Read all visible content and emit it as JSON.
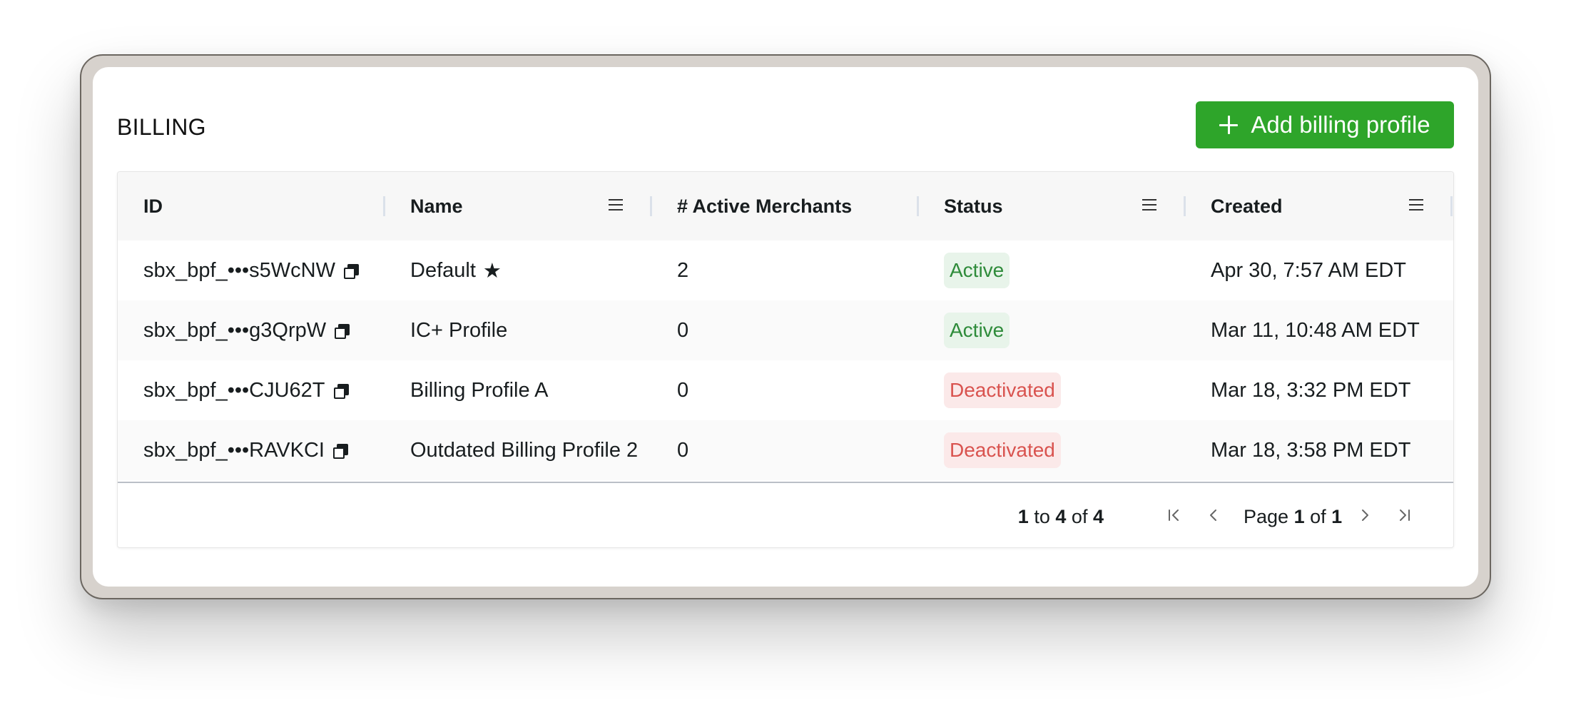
{
  "page": {
    "title": "BILLING",
    "add_button_label": "Add billing profile"
  },
  "colors": {
    "accent": "#2ea52a",
    "active_text": "#2e8b3a",
    "active_bg": "#e8f4ea",
    "deactivated_text": "#d9534f",
    "deactivated_bg": "#fbe9e9"
  },
  "table": {
    "columns": [
      "ID",
      "Name",
      "# Active Merchants",
      "Status",
      "Created"
    ],
    "rows": [
      {
        "id": "sbx_bpf_•••s5WcNW",
        "name": "Default",
        "default": true,
        "active_merchants": "2",
        "status": "Active",
        "created": "Apr 30, 7:57 AM EDT"
      },
      {
        "id": "sbx_bpf_•••g3QrpW",
        "name": "IC+ Profile",
        "default": false,
        "active_merchants": "0",
        "status": "Active",
        "created": "Mar 11, 10:48 AM EDT"
      },
      {
        "id": "sbx_bpf_•••CJU62T",
        "name": "Billing Profile A",
        "default": false,
        "active_merchants": "0",
        "status": "Deactivated",
        "created": "Mar 18, 3:32 PM EDT"
      },
      {
        "id": "sbx_bpf_•••RAVKCI",
        "name": "Outdated Billing Profile 2",
        "default": false,
        "active_merchants": "0",
        "status": "Deactivated",
        "created": "Mar 18, 3:58 PM EDT"
      }
    ]
  },
  "pagination": {
    "from": "1",
    "to_word": "to",
    "to": "4",
    "of_word": "of",
    "total": "4",
    "page_word": "Page",
    "page": "1",
    "page_of_word": "of",
    "pages": "1"
  },
  "icons": {
    "add": "plus-icon",
    "copy": "copy-icon",
    "default_marker": "star-icon",
    "column_menu": "menu-icon",
    "first_page": "first-page-icon",
    "previous_page": "previous-page-icon",
    "next_page": "next-page-icon",
    "last_page": "last-page-icon"
  }
}
